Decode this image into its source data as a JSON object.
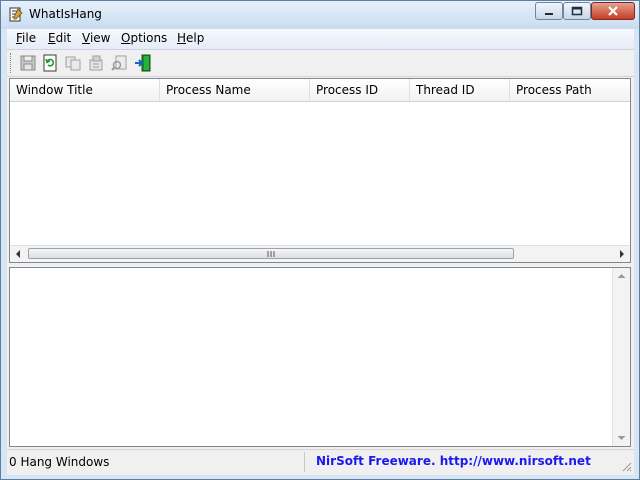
{
  "window": {
    "title": "WhatIsHang",
    "minimize_icon": "minimize-icon",
    "maximize_icon": "maximize-icon",
    "close_icon": "close-icon"
  },
  "menu": [
    {
      "label_ul": "F",
      "label_rest": "ile"
    },
    {
      "label_ul": "E",
      "label_rest": "dit"
    },
    {
      "label_ul": "V",
      "label_rest": "iew"
    },
    {
      "label_ul": "O",
      "label_rest": "ptions"
    },
    {
      "label_ul": "H",
      "label_rest": "elp"
    }
  ],
  "toolbar": {
    "icons": [
      "save-icon",
      "refresh-icon",
      "copy-icon",
      "properties-icon",
      "find-icon",
      "exit-icon"
    ]
  },
  "list": {
    "columns": [
      "Window Title",
      "Process Name",
      "Process ID",
      "Thread ID",
      "Process Path"
    ]
  },
  "status": {
    "count_text": "0 Hang Windows",
    "link_text": "NirSoft Freeware.  http://www.nirsoft.net"
  },
  "colors": {
    "link": "#1a1aee",
    "close_button": "#c43d24"
  }
}
